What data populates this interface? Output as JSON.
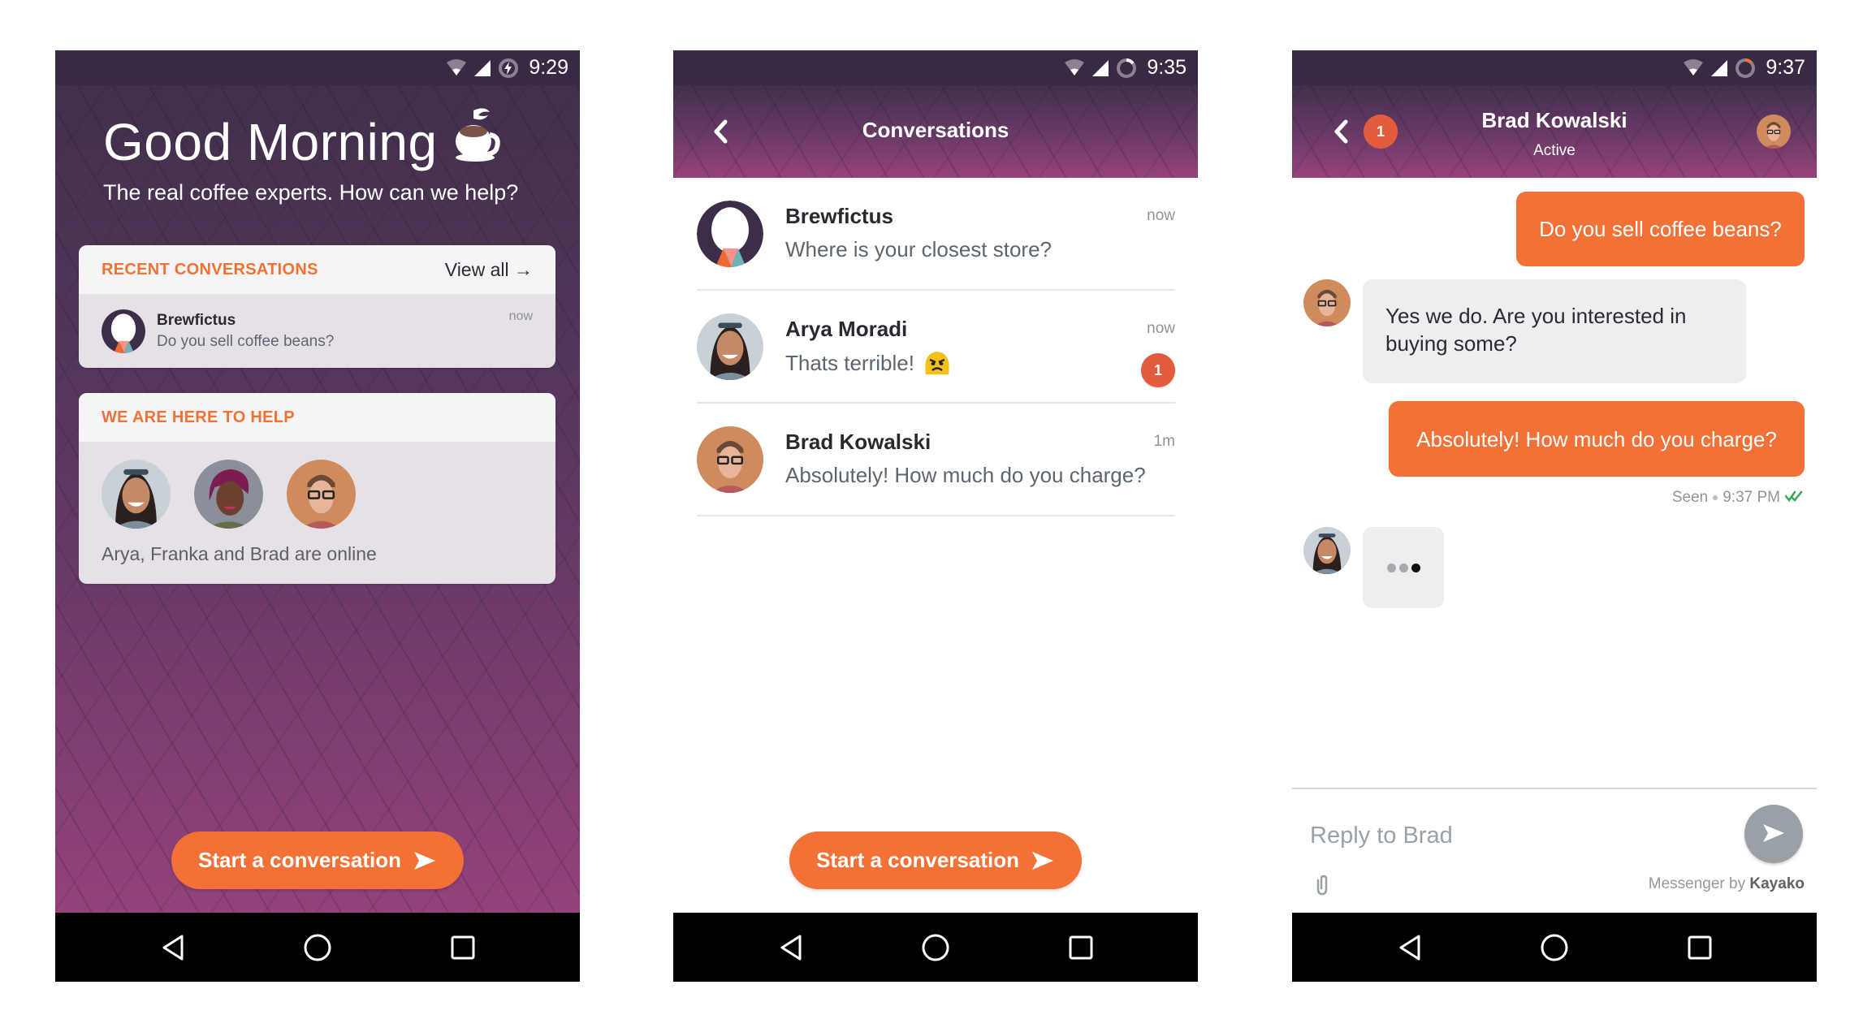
{
  "colors": {
    "accent": "#f27137",
    "badge": "#e35b3d",
    "status_bar": "#382a44",
    "header_gradient_top": "#41304c",
    "header_gradient_bottom": "#93427a",
    "seen_check": "#3aa55a"
  },
  "home": {
    "status_time": "9:29",
    "greeting": "Good Morning",
    "greeting_icon": "coffee-cup-icon",
    "subtitle": "The real coffee experts. How can we help?",
    "recent": {
      "title": "RECENT CONVERSATIONS",
      "view_all": "View all →",
      "item": {
        "name": "Brewfictus",
        "message": "Do you sell coffee beans?",
        "time": "now"
      }
    },
    "help": {
      "title": "WE ARE HERE TO HELP",
      "agents": [
        "Arya",
        "Franka",
        "Brad"
      ],
      "online_text": "Arya, Franka and Brad are online"
    },
    "cta": "Start a conversation"
  },
  "conversations": {
    "status_time": "9:35",
    "title": "Conversations",
    "items": [
      {
        "name": "Brewfictus",
        "message": "Where is your closest store?",
        "time": "now",
        "unread": null,
        "emoji": null
      },
      {
        "name": "Arya Moradi",
        "message": "Thats terrible!",
        "time": "now",
        "unread": "1",
        "emoji": "angry-face"
      },
      {
        "name": "Brad Kowalski",
        "message": "Absolutely! How much do you charge?",
        "time": "1m",
        "unread": null,
        "emoji": null
      }
    ],
    "cta": "Start a conversation"
  },
  "chat": {
    "status_time": "9:37",
    "unread_badge": "1",
    "contact_name": "Brad Kowalski",
    "contact_status": "Active",
    "messages": [
      {
        "direction": "out",
        "text": "Do you sell coffee beans?"
      },
      {
        "direction": "in",
        "sender": "Brad",
        "text": "Yes we do. Are you interested in buying some?"
      },
      {
        "direction": "out",
        "text": "Absolutely! How much do you charge?"
      }
    ],
    "seen_label": "Seen",
    "seen_time": "9:37 PM",
    "typing_sender": "Arya",
    "reply_placeholder": "Reply to Brad",
    "powered_prefix": "Messenger by",
    "powered_brand": "Kayako"
  }
}
